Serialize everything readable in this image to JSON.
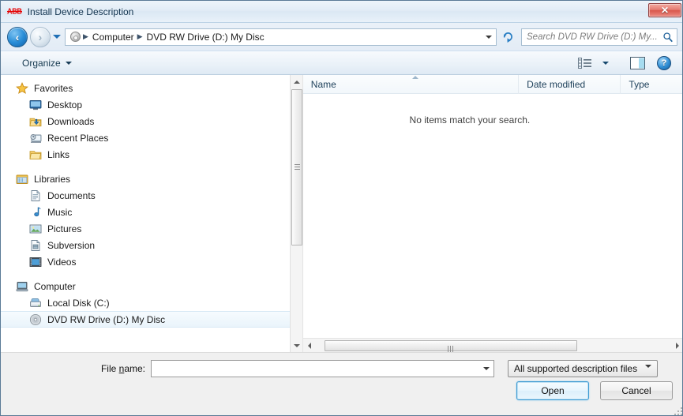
{
  "window": {
    "logo": "ABB",
    "title": "Install Device Description",
    "close_label": "✕"
  },
  "nav": {
    "back_label": "◀",
    "forward_label": "▶",
    "history_label": "▼",
    "refresh_label": "refresh",
    "breadcrumbs": [
      "Computer",
      "DVD RW Drive (D:) My Disc"
    ],
    "separator": "▶",
    "address_icon": "disc-icon"
  },
  "search": {
    "placeholder": "Search DVD RW Drive (D:) My...",
    "value": "",
    "icon": "search-icon"
  },
  "toolbar": {
    "organize_label": "Organize",
    "view_icon": "view-list-icon",
    "preview_icon": "preview-pane-icon",
    "help_label": "?"
  },
  "sidebar": {
    "groups": [
      {
        "label": "Favorites",
        "icon": "star-icon",
        "items": [
          {
            "label": "Desktop",
            "icon": "desktop-icon"
          },
          {
            "label": "Downloads",
            "icon": "downloads-icon"
          },
          {
            "label": "Recent Places",
            "icon": "recent-places-icon"
          },
          {
            "label": "Links",
            "icon": "folder-icon"
          }
        ]
      },
      {
        "label": "Libraries",
        "icon": "libraries-icon",
        "items": [
          {
            "label": "Documents",
            "icon": "document-icon"
          },
          {
            "label": "Music",
            "icon": "music-note-icon"
          },
          {
            "label": "Pictures",
            "icon": "picture-icon"
          },
          {
            "label": "Subversion",
            "icon": "subversion-icon"
          },
          {
            "label": "Videos",
            "icon": "video-icon"
          }
        ]
      },
      {
        "label": "Computer",
        "icon": "computer-icon",
        "items": [
          {
            "label": "Local Disk (C:)",
            "icon": "hard-disk-icon",
            "selected": false
          },
          {
            "label": "DVD RW Drive (D:) My Disc",
            "icon": "optical-disc-icon",
            "selected": true
          }
        ]
      }
    ]
  },
  "file_list": {
    "columns": [
      {
        "label": "Name",
        "sort": "ascending"
      },
      {
        "label": "Date modified",
        "sort": ""
      },
      {
        "label": "Type",
        "sort": ""
      }
    ],
    "empty_message": "No items match your search.",
    "rows": []
  },
  "footer": {
    "filename_label_pre": "File ",
    "filename_label_accel": "n",
    "filename_label_post": "ame:",
    "filename_value": "",
    "filter_value": "All supported description files (",
    "open_label": "Open",
    "cancel_label": "Cancel"
  },
  "colors": {
    "accent": "#2a8ed8",
    "close_red": "#d9574c",
    "logo_red": "#e60000",
    "dialog_bg": "#f0f0f0",
    "frame_border": "#5a7a96"
  }
}
